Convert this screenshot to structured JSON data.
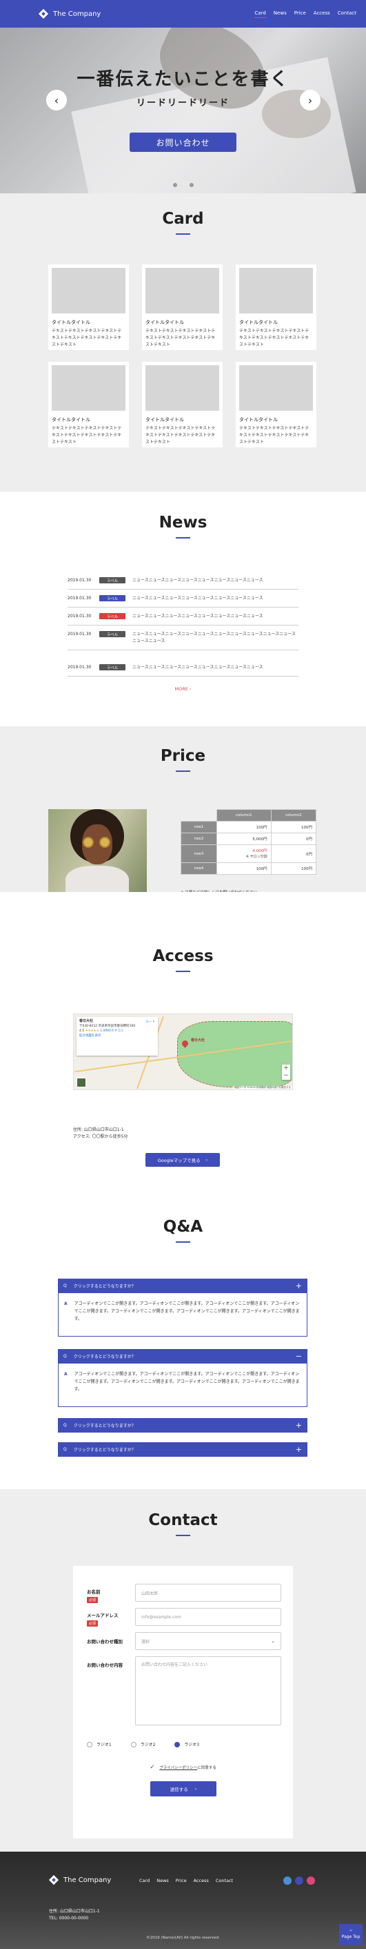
{
  "header": {
    "logo_text": "The Company",
    "nav": [
      "Card",
      "News",
      "Price",
      "Access",
      "Contact"
    ],
    "active_nav": "Card",
    "accent_color": "#3f4db8"
  },
  "hero": {
    "title": "一番伝えたいことを書く",
    "subtitle": "リードリードリード",
    "button_label": "お問い合わせ",
    "prev_icon": "‹",
    "next_icon": "›"
  },
  "card": {
    "title": "Card",
    "items": [
      {
        "title": "タイトルタイトル",
        "text": "テキストテキストテキストテキストテキストテキストテキストテキストテキストテキスト"
      },
      {
        "title": "タイトルタイトル",
        "text": "テキストテキストテキストテキストテキストテキストテキストテキストテキストテキスト"
      },
      {
        "title": "タイトルタイトル",
        "text": "テキストテキストテキストテキストテキストテキストテキストテキストテキストテキスト"
      },
      {
        "title": "タイトルタイトル",
        "text": "テキストテキストテキストテキストテキストテキストテキストテキストテキストテキスト"
      },
      {
        "title": "タイトルタイトル",
        "text": "テキストテキストテキストテキストテキストテキストテキストテキストテキストテキスト"
      },
      {
        "title": "タイトルタイトル",
        "text": "テキストテキストテキストテキストテキストテキストテキストテキストテキストテキスト"
      }
    ]
  },
  "news": {
    "title": "News",
    "items": [
      {
        "date": "2019.01.30",
        "label": "ラベル",
        "color": "#555555",
        "text": "ニュースニュースニュースニュースニュースニュースニュースニュース"
      },
      {
        "date": "2019.01.30",
        "label": "ラベル",
        "color": "#3f4db8",
        "text": "ニュースニュースニュースニュースニュースニュースニュースニュース"
      },
      {
        "date": "2019.01.30",
        "label": "ラベル",
        "color": "#d93f3f",
        "text": "ニュースニュースニュースニュースニュースニュースニュースニュース"
      },
      {
        "date": "2019.01.30",
        "label": "ラベル",
        "color": "#555555",
        "text": "ニュースニュースニュースニュースニュースニュースニュースニュースニュースニュースニュースニュース"
      },
      {
        "date": "2019.01.30",
        "label": "ラベル",
        "color": "#555555",
        "text": "ニュースニュースニュースニュースニュースニュースニュースニュース"
      }
    ],
    "more_label": "MORE"
  },
  "price": {
    "title": "Price",
    "columns": [
      "column1",
      "column2"
    ],
    "rows": [
      {
        "label": "row1",
        "c1": "100円",
        "c2": "100円"
      },
      {
        "label": "row2",
        "c1": "5,000円",
        "c2": "0円"
      },
      {
        "label": "row3",
        "c1": "4,000円",
        "c1_note": "※ サロン分割",
        "c2": "0円"
      },
      {
        "label": "row4",
        "c1": "100円",
        "c2": "100円"
      }
    ],
    "note_prefix": "※ 注意などの詳しくは",
    "note_link": "お問い合わせ",
    "note_suffix": "ください"
  },
  "access": {
    "title": "Access",
    "map": {
      "place_name": "春日大社",
      "place_address": "〒630-8212 奈良県奈良市春日野町160",
      "rating": "4.5",
      "stars": "★★★★★",
      "reviews": "1,9件のクチコミ",
      "larger_map": "拡大地図を表示",
      "directions": "ルート",
      "pin_label": "春日大社",
      "map_footer": "地図データ ©2019 利用規約 地図の誤りを報告する"
    },
    "address_line1": "住所: 山口県山口市山口1-1",
    "address_line2": "アクセス: 〇〇駅から徒歩5分",
    "button_label": "Googleマップで見る"
  },
  "qa": {
    "title": "Q&A",
    "q_mark": "Q",
    "a_mark": "A",
    "items": [
      {
        "question": "クリックするとどうなりますか？",
        "open": false,
        "icon": "+"
      },
      {
        "question": "クリックするとどうなりますか？",
        "open": true,
        "icon": "−",
        "answer": "アコーディオンでここが開きます。アコーディオンでここが開きます。アコーディオンでここが開きます。アコーディオンでここが開きます。アコーディオンでここが開きます。アコーディオンでここが開きます。アコーディオンでここが開きます。"
      },
      {
        "question": "クリックするとどうなりますか？",
        "open": true,
        "icon": "−",
        "answer": "アコーディオンでここが開きます。アコーディオンでここが開きます。アコーディオンでここが開きます。アコーディオンでここが開きます。アコーディオンでここが開きます。アコーディオンでここが開きます。アコーディオンでここが開きます。"
      },
      {
        "question": "クリックするとどうなりますか？",
        "open": false,
        "icon": "+"
      },
      {
        "question": "クリックするとどうなりますか？",
        "open": false,
        "icon": "+"
      }
    ]
  },
  "contact": {
    "title": "Contact",
    "required": "必須",
    "fields": {
      "name": {
        "label": "お名前",
        "placeholder": "山田太郎"
      },
      "email": {
        "label": "メールアドレス",
        "placeholder": "info@example.com"
      },
      "type": {
        "label": "お問い合わせ種別",
        "placeholder": "選択"
      },
      "message": {
        "label": "お問い合わせ内容",
        "placeholder": "お問い合わせ内容をご記入ください"
      }
    },
    "radios": [
      {
        "label": "ラジオ1",
        "checked": false
      },
      {
        "label": "ラジオ2",
        "checked": false
      },
      {
        "label": "ラジオ3",
        "checked": true
      }
    ],
    "privacy_link": "プライバシーポリシー",
    "privacy_suffix": "に同意する",
    "submit_label": "送信する"
  },
  "footer": {
    "logo_text": "The Company",
    "nav": [
      "Card",
      "News",
      "Price",
      "Access",
      "Contact"
    ],
    "address": "住所: 山口県山口市山口1-1",
    "tel": "TEL: 0000-00-0000",
    "social_colors": [
      "#4a90d9",
      "#3f4db8",
      "#e0457a"
    ],
    "copyright": "©2019 (Name)(All) All rights reserved.",
    "page_top": "Page Top"
  }
}
